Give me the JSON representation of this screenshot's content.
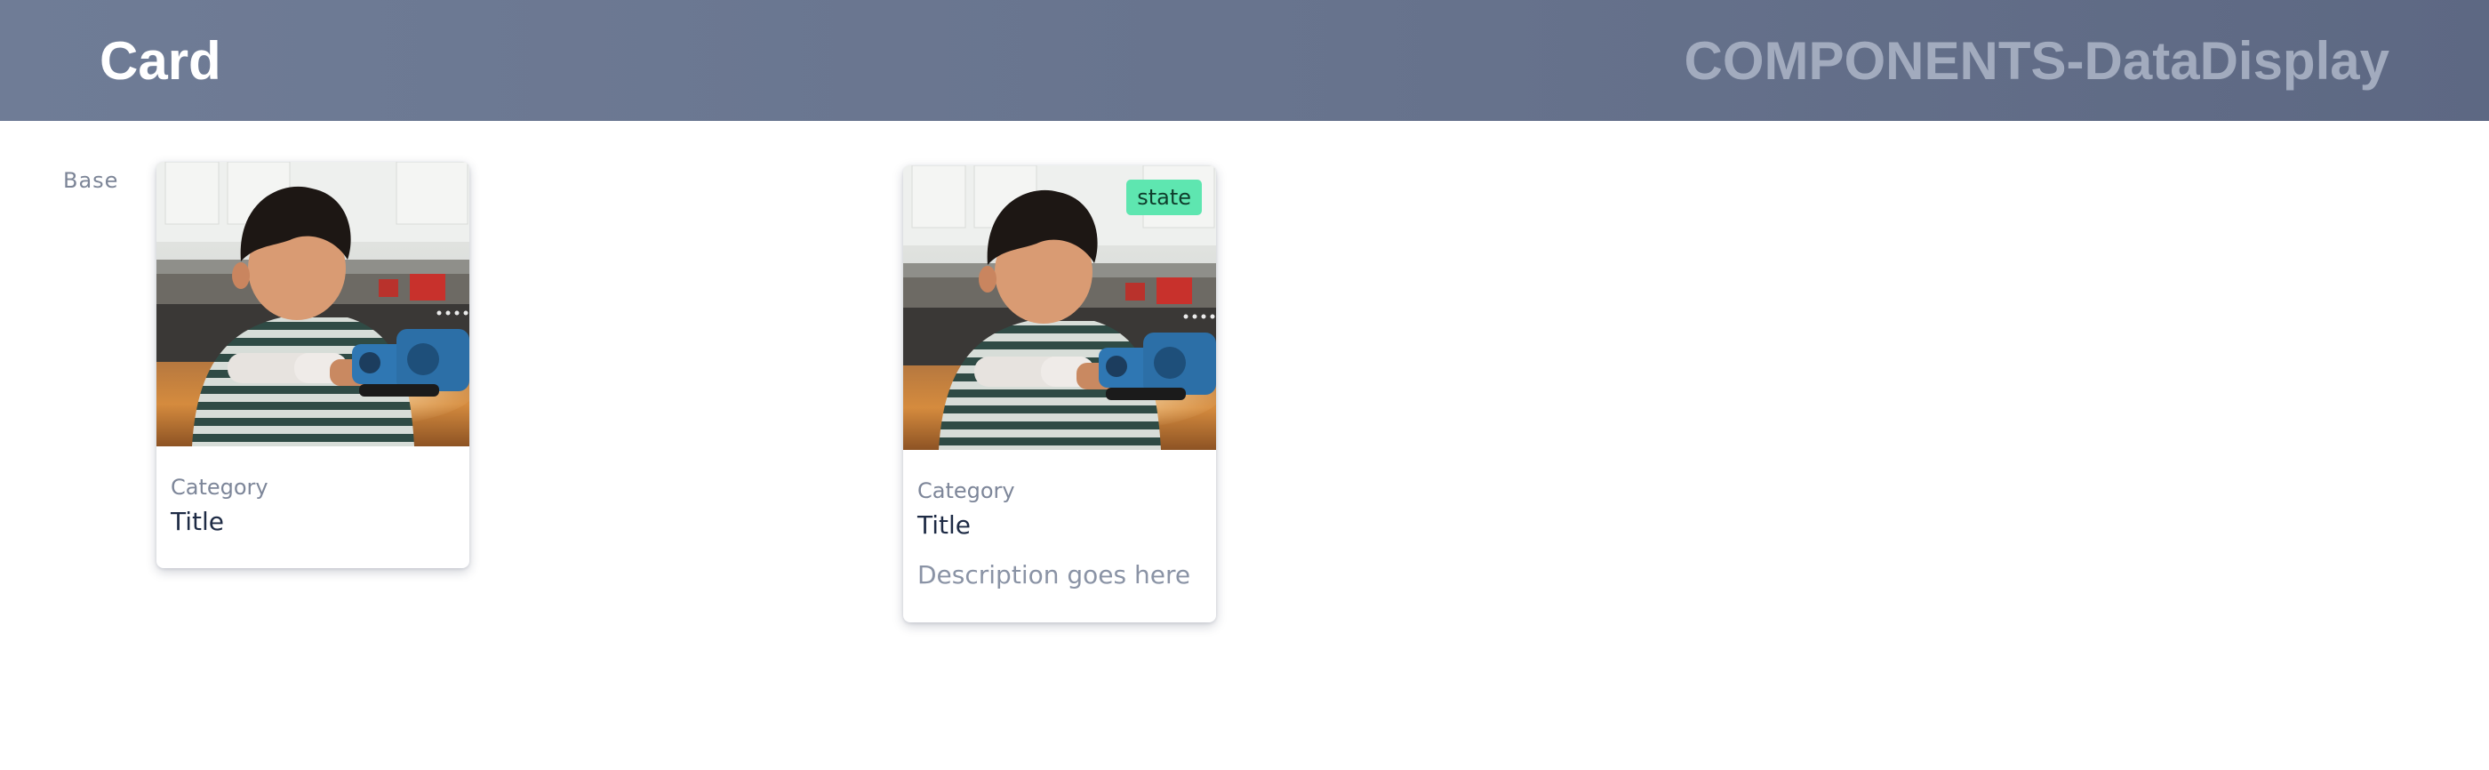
{
  "header": {
    "title": "Card",
    "section": "COMPONENTS-DataDisplay"
  },
  "row": {
    "label": "Base"
  },
  "cards": [
    {
      "category": "Category",
      "title": "Title",
      "image": "child-playing-with-toy-robot-photo"
    },
    {
      "category": "Category",
      "title": "Title",
      "description": "Description goes here",
      "badge": "state",
      "image": "child-playing-with-toy-robot-photo"
    }
  ],
  "colors": {
    "header_bg": "#6a7690",
    "badge_bg": "#5ee6b0",
    "title_text": "#1e2b45",
    "muted_text": "#7d8699"
  }
}
